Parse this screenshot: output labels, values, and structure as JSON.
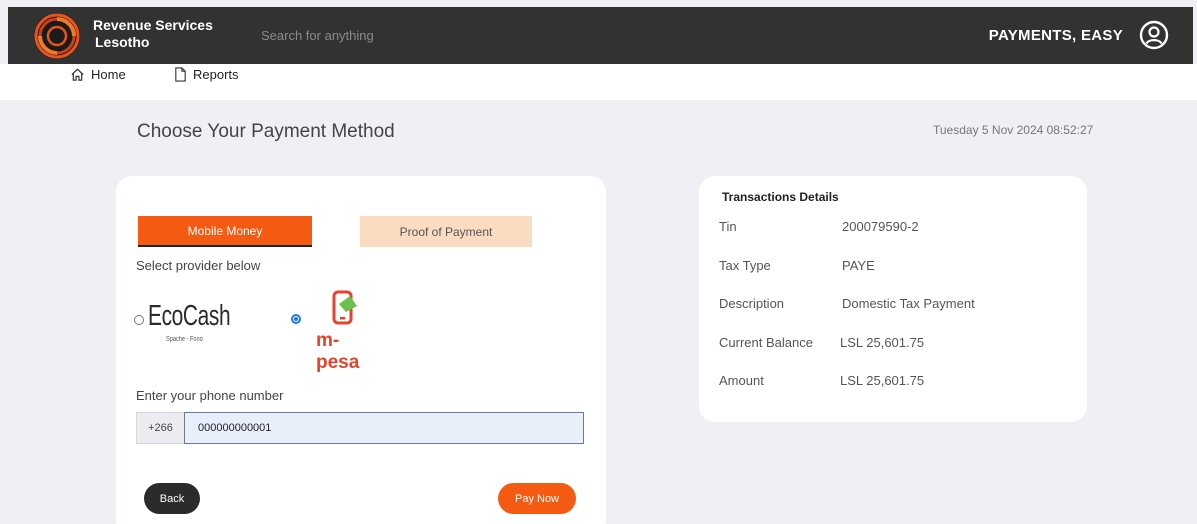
{
  "header": {
    "brand_line1": "Revenue Services",
    "brand_line2": "Lesotho",
    "search_placeholder": "Search for anything",
    "tagline": "PAYMENTS, EASY"
  },
  "nav": {
    "home": "Home",
    "reports": "Reports"
  },
  "page": {
    "title": "Choose Your Payment Method",
    "datetime": "Tuesday 5 Nov 2024 08:52:27"
  },
  "payment": {
    "tabs": [
      "Mobile Money",
      "Proof of Payment"
    ],
    "active_tab": "Mobile Money",
    "provider_prompt": "Select provider below",
    "providers": [
      {
        "name": "EcoCash",
        "tagline": "Spache - Fono",
        "selected": false
      },
      {
        "name": "m-pesa",
        "selected": true
      }
    ],
    "phone_label": "Enter your phone number",
    "country_code": "+266",
    "phone_value": "000000000001",
    "back_label": "Back",
    "pay_label": "Pay Now"
  },
  "transaction": {
    "title": "Transactions Details",
    "rows": [
      {
        "label": "Tin",
        "value": "200079590-2"
      },
      {
        "label": "Tax Type",
        "value": "PAYE"
      },
      {
        "label": "Description",
        "value": "Domestic Tax Payment"
      },
      {
        "label": "Current Balance",
        "value": "LSL 25,601.75"
      },
      {
        "label": "Amount",
        "value": "LSL 25,601.75"
      }
    ]
  },
  "colors": {
    "accent": "#f55a12",
    "header_bg": "#323232",
    "page_bg": "#eef0f4",
    "proof_tab_bg": "#fbdcc0",
    "mpesa_red": "#e8412c",
    "mpesa_green": "#6cbf4b"
  },
  "icons": {
    "home": "home-icon",
    "reports": "document-icon",
    "user": "user-circle-icon",
    "logo": "rsl-logo"
  }
}
